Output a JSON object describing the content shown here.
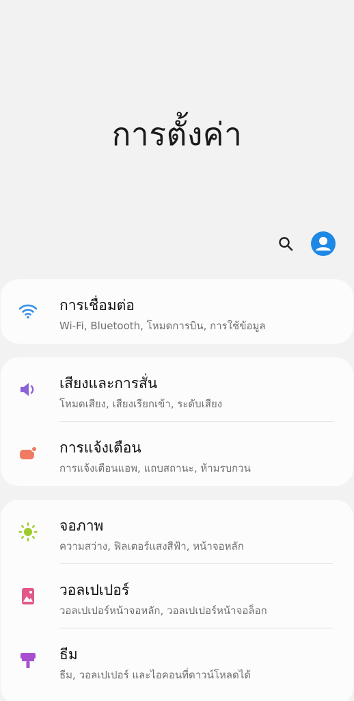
{
  "header": {
    "title": "การตั้งค่า"
  },
  "toolbar": {
    "search_icon": "search-icon",
    "account_icon": "account-icon"
  },
  "groups": [
    {
      "items": [
        {
          "label": "การเชื่อมต่อ",
          "sub": "Wi-Fi, Bluetooth, โหมดการบิน, การใช้ข้อมูล",
          "icon": "wifi-icon",
          "color": "#3a8ee6"
        }
      ]
    },
    {
      "items": [
        {
          "label": "เสียงและการสั่น",
          "sub": "โหมดเสียง, เสียงเรียกเข้า, ระดับเสียง",
          "icon": "speaker-icon",
          "color": "#8a64d6"
        },
        {
          "label": "การแจ้งเตือน",
          "sub": "การแจ้งเตือนแอพ, แถบสถานะ, ห้ามรบกวน",
          "icon": "notification-icon",
          "color": "#f07a62"
        }
      ]
    },
    {
      "items": [
        {
          "label": "จอภาพ",
          "sub": "ความสว่าง, ฟิลเตอร์แสงสีฟ้า, หน้าจอหลัก",
          "icon": "brightness-icon",
          "color": "#9ccc2a"
        },
        {
          "label": "วอลเปเปอร์",
          "sub": "วอลเปเปอร์หน้าจอหลัก, วอลเปเปอร์หน้าจอล็อก",
          "icon": "wallpaper-icon",
          "color": "#e2588a"
        },
        {
          "label": "ธีม",
          "sub": "ธีม, วอลเปเปอร์ และไอคอนที่ดาวน์โหลดได้",
          "icon": "theme-icon",
          "color": "#a64fd0"
        }
      ]
    }
  ]
}
